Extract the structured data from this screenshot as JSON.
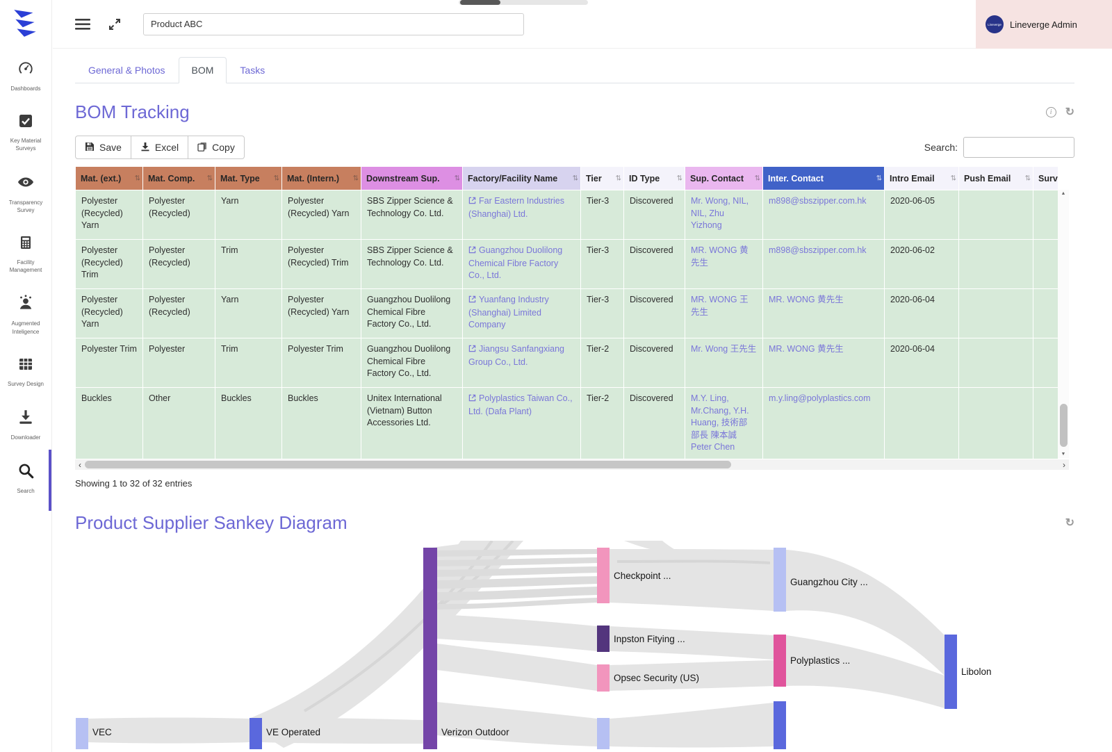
{
  "colors": {
    "accent": "#6d68d5",
    "link": "#7a76d9",
    "header_mat": "#c77f5f",
    "header_downstream": "#dd8fe3",
    "header_factory": "#d7d3ef",
    "header_plain": "#f4f3fb",
    "header_sup_contact": "#eab7ef",
    "header_inter_contact": "#4062c8",
    "row_green": "#d7ead9",
    "user_panel_pink": "#f6e3e2",
    "logo_blue": "#2b3fd6",
    "sidebar_active": "#5b51c8"
  },
  "icons": {
    "sort": "⇅",
    "up": "▲",
    "down": "▼",
    "left": "‹",
    "right": "›",
    "refresh": "↻",
    "info": "i"
  },
  "topbar": {
    "product_value": "Product ABC",
    "user_name": "Lineverge Admin",
    "avatar_label": "Lineverge"
  },
  "sidebar": {
    "items": [
      {
        "label": "Dashboards",
        "icon": "dashboards-icon"
      },
      {
        "label": "Key Material Surveys",
        "icon": "key-material-surveys-icon"
      },
      {
        "label": "Transparency Survey",
        "icon": "transparency-survey-icon"
      },
      {
        "label": "Facility Management",
        "icon": "facility-management-icon"
      },
      {
        "label": "Augmented Inteligence",
        "icon": "augmented-intelligence-icon"
      },
      {
        "label": "Survey Design",
        "icon": "survey-design-icon"
      },
      {
        "label": "Downloader",
        "icon": "downloader-icon"
      },
      {
        "label": "Search",
        "icon": "search-icon",
        "active": true
      }
    ]
  },
  "tabs": [
    {
      "label": "General & Photos",
      "active": false
    },
    {
      "label": "BOM",
      "active": true
    },
    {
      "label": "Tasks",
      "active": false
    }
  ],
  "bom": {
    "title": "BOM Tracking",
    "toolbar": {
      "save": "Save",
      "excel": "Excel",
      "copy": "Copy"
    },
    "search_label": "Search:",
    "search_value": "",
    "showing": "Showing 1 to 32 of 32 entries",
    "table": {
      "columns": [
        {
          "label": "Mat. (ext.)",
          "style": "mat"
        },
        {
          "label": "Mat. Comp.",
          "style": "mat"
        },
        {
          "label": "Mat. Type",
          "style": "mat"
        },
        {
          "label": "Mat. (Intern.)",
          "style": "mat"
        },
        {
          "label": "Downstream Sup.",
          "style": "orchid"
        },
        {
          "label": "Factory/Facility Name",
          "style": "lav",
          "cell": "extlink"
        },
        {
          "label": "Tier",
          "style": "plain"
        },
        {
          "label": "ID Type",
          "style": "plain"
        },
        {
          "label": "Sup. Contact",
          "style": "pink",
          "cell": "link"
        },
        {
          "label": "Inter. Contact",
          "style": "blue",
          "cell": "link"
        },
        {
          "label": "Intro Email",
          "style": "plain"
        },
        {
          "label": "Push Email",
          "style": "plain"
        },
        {
          "label": "Survey",
          "style": "plain",
          "sortable": false
        }
      ],
      "rows": [
        [
          "Polyester (Recycled) Yarn",
          "Polyester (Recycled)",
          "Yarn",
          "Polyester (Recycled) Yarn",
          "SBS Zipper Science & Technology Co. Ltd.",
          "Far Eastern Industries (Shanghai) Ltd.",
          "Tier-3",
          "Discovered",
          "Mr. Wong, NIL, NIL, Zhu Yizhong",
          "m898@sbszipper.com.hk",
          "2020-06-05",
          "",
          ""
        ],
        [
          "Polyester (Recycled) Trim",
          "Polyester (Recycled)",
          "Trim",
          "Polyester (Recycled) Trim",
          "SBS Zipper Science & Technology Co. Ltd.",
          "Guangzhou Duolilong Chemical Fibre Factory Co., Ltd.",
          "Tier-3",
          "Discovered",
          "MR. WONG 黄先生",
          "m898@sbszipper.com.hk",
          "2020-06-02",
          "",
          ""
        ],
        [
          "Polyester (Recycled) Yarn",
          "Polyester (Recycled)",
          "Yarn",
          "Polyester (Recycled) Yarn",
          "Guangzhou Duolilong Chemical Fibre Factory Co., Ltd.",
          "Yuanfang Industry (Shanghai) Limited Company",
          "Tier-3",
          "Discovered",
          "MR. WONG 王先生",
          "MR. WONG 黄先生",
          "2020-06-04",
          "",
          ""
        ],
        [
          "Polyester Trim",
          "Polyester",
          "Trim",
          "Polyester Trim",
          "Guangzhou Duolilong Chemical Fibre Factory Co., Ltd.",
          "Jiangsu Sanfangxiang Group Co., Ltd.",
          "Tier-2",
          "Discovered",
          "Mr. Wong 王先生",
          "MR. WONG 黄先生",
          "2020-06-04",
          "",
          ""
        ],
        [
          "Buckles",
          "Other",
          "Buckles",
          "Buckles",
          "Unitex International (Vietnam) Button Accessories Ltd.",
          "Polyplastics Taiwan Co., Ltd. (Dafa Plant)",
          "Tier-2",
          "Discovered",
          "M.Y. Ling, Mr.Chang, Y.H. Huang, 技術部 部長 陳本誠 Peter Chen",
          "m.y.ling@polyplastics.com",
          "",
          "",
          ""
        ]
      ]
    }
  },
  "sankey": {
    "title": "Product Supplier Sankey Diagram",
    "nodes": [
      {
        "label": "VEC",
        "color": "#b6c0f3"
      },
      {
        "label": "VE Operated",
        "color": "#5a68dd"
      },
      {
        "label": "Verizon Outdoor",
        "color": "#7445a8"
      },
      {
        "label": "Checkpoint ...",
        "color": "#f295bd"
      },
      {
        "label": "Inpston Fitying ...",
        "color": "#53357d"
      },
      {
        "label": "Opsec Security (US)",
        "color": "#f295bd"
      },
      {
        "label": "",
        "color": "#b6c0f3"
      },
      {
        "label": "Guangzhou City ...",
        "color": "#b6c0f3"
      },
      {
        "label": "Polyplastics ...",
        "color": "#e0549c"
      },
      {
        "label": "",
        "color": "#5a68dd"
      },
      {
        "label": "Libolon",
        "color": "#5a68dd"
      }
    ]
  }
}
